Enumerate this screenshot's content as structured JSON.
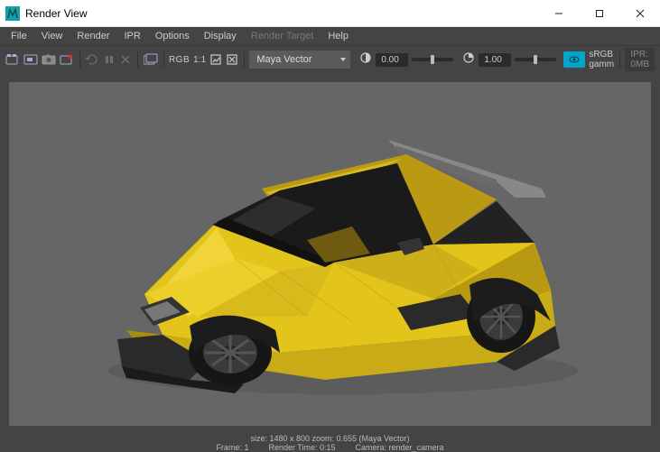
{
  "title": "Render View",
  "menu": {
    "file": "File",
    "view": "View",
    "render": "Render",
    "ipr": "IPR",
    "options": "Options",
    "display": "Display",
    "render_target": "Render Target",
    "help": "Help"
  },
  "toolbar": {
    "renderer_label": "Maya Vector",
    "exposure_value": "0.00",
    "gamma_value": "1.00",
    "ratio_label": "1:1",
    "rgb_label": "RGB",
    "color_mgmt": "sRGB gamm",
    "ipr_mem": "IPR: 0MB"
  },
  "status": {
    "size_line": "size: 1480 x 800  zoom: 0.655        (Maya Vector)",
    "frame": "Frame: 1",
    "render_time": "Render Time: 0:15",
    "camera": "Camera: render_camera"
  }
}
